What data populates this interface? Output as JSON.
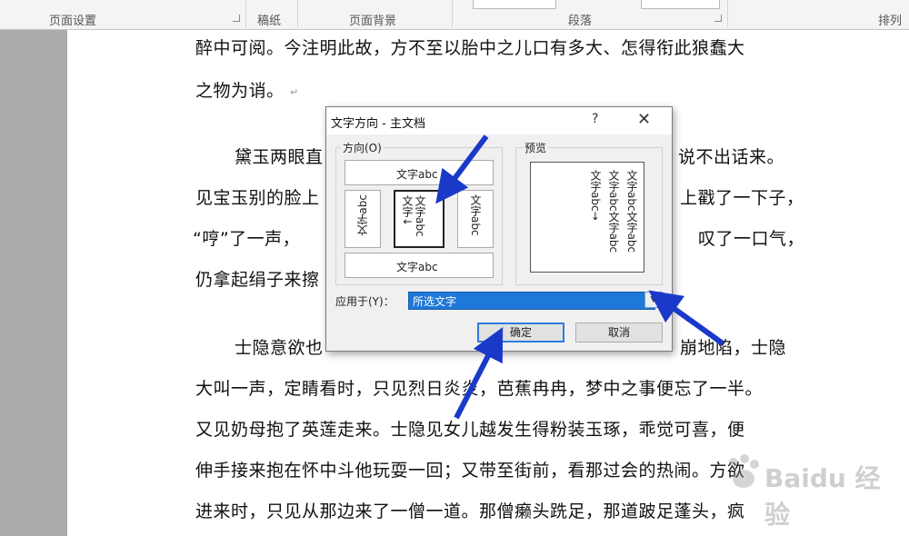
{
  "ribbon": {
    "groups": [
      "页面设置",
      "稿纸",
      "页面背景",
      "段落",
      "排列"
    ]
  },
  "document": {
    "lines": [
      "醉中可阅。今注明此故，方不至以胎中之儿口有多大、怎得衔此狼蠢大",
      "之物为诮。",
      "黛玉两眼直",
      "说不出话来。",
      "见宝玉别的脸上",
      "上戳了一下子，",
      "“哼”了一声，",
      "叹了一口气，",
      "仍拿起绢子来擦",
      "士隐意欲也",
      "崩地陷，士隐",
      "大叫一声，定睛看时，只见烈日炎炎，芭蕉冉冉，梦中之事便忘了一半。",
      "又见奶母抱了英莲走来。士隐见女儿越发生得粉装玉琢，乖觉可喜，便",
      "伸手接来抱在怀中斗他玩耍一回；又带至街前，看那过会的热闹。方欲",
      "进来时，只见从那边来了一僧一道。那僧癞头跣足，那道跛足蓬头，疯"
    ],
    "para_mark": "↵"
  },
  "dialog": {
    "title": "文字方向 - 主文档",
    "help": "?",
    "close": "✕",
    "direction_label": "方向(O)",
    "preview_label": "预览",
    "options": {
      "horizontal": "文字abc",
      "vertical_left": "文字abc",
      "vertical_selected": "文字abc文字↓",
      "vertical_right": "文字abc",
      "bottom": "文字abc"
    },
    "preview_columns": [
      "文字abc文字abc",
      "文字abc文字abc",
      "文字abc→"
    ],
    "apply_label": "应用于(Y)：",
    "apply_value": "所选文字",
    "ok": "确定",
    "cancel": "取消"
  },
  "watermark": {
    "text": "Baidu 经验"
  }
}
